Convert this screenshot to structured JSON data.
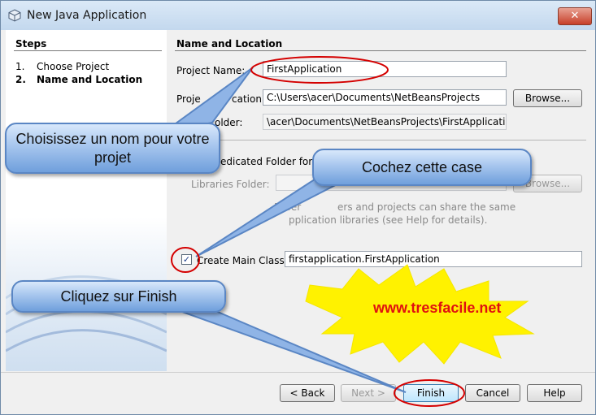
{
  "window": {
    "title": "New Java Application",
    "close_label": "✕"
  },
  "steps": {
    "title": "Steps",
    "items": [
      {
        "num": "1.",
        "label": "Choose Project"
      },
      {
        "num": "2.",
        "label": "Name and Location"
      }
    ]
  },
  "form": {
    "section_title": "Name and Location",
    "project_name_label": "Project Name:",
    "project_name_value": "FirstApplication",
    "project_location_label_visible": "Proje",
    "project_location_label_tail": "cation:",
    "project_location_value": "C:\\Users\\acer\\Documents\\NetBeansProjects",
    "browse_label": "Browse...",
    "project_folder_label_visible": "ect Folder:",
    "project_folder_value": "\\acer\\Documents\\NetBeansProjects\\FirstApplication",
    "dedicated_folder_label": "edicated Folder for",
    "libraries_folder_label": "Libraries Folder:",
    "libraries_browse_label": "Browse...",
    "info_line1_a": "Differ",
    "info_line1_b": "ers and projects can share the same",
    "info_line2": "pplication libraries (see Help for details).",
    "create_main_label": "Create Main Class",
    "create_main_checked": "✓",
    "main_class_value": "firstapplication.FirstApplication"
  },
  "buttons": {
    "back": "< Back",
    "next": "Next >",
    "finish": "Finish",
    "cancel": "Cancel",
    "help": "Help"
  },
  "callouts": {
    "name": "Choisissez un nom pour votre projet",
    "check": "Cochez cette case",
    "finish": "Cliquez sur Finish"
  },
  "watermark": "www.tresfacile.net",
  "colors": {
    "highlight_ring": "#d40000",
    "bubble_border": "#5a86c4",
    "star_fill": "#fff200"
  }
}
